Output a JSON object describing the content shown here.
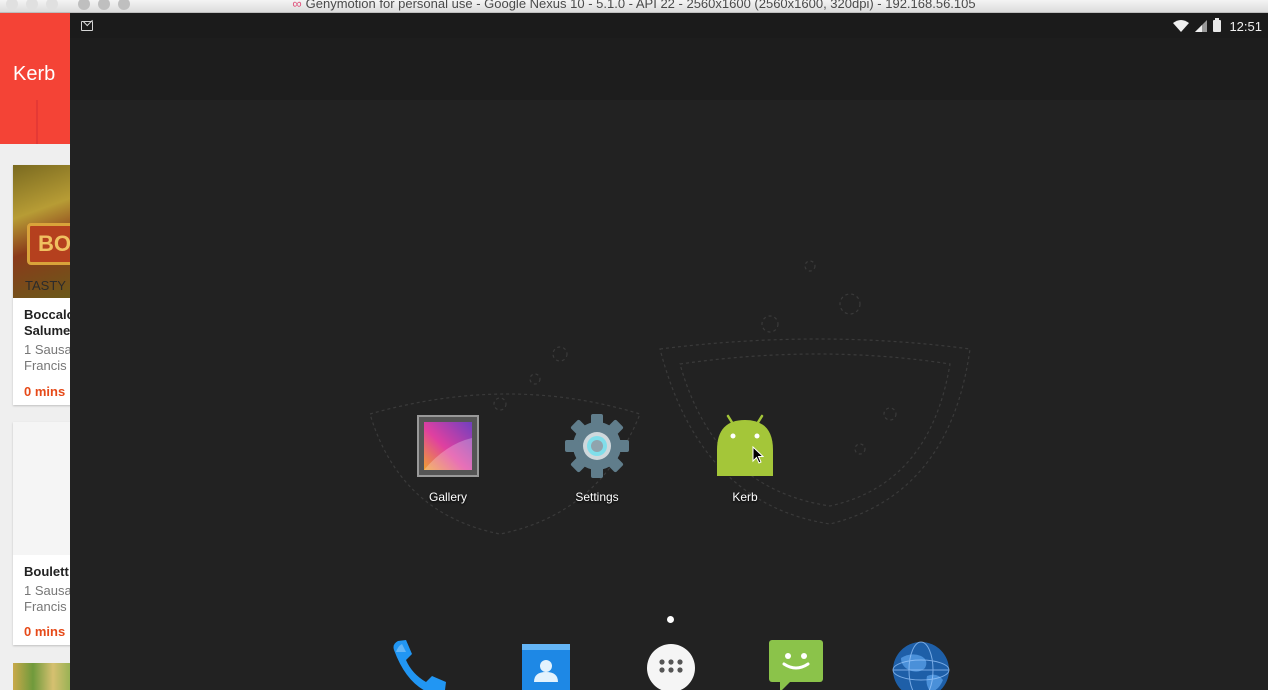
{
  "window": {
    "title": "Genymotion for personal use - Google Nexus 10 - 5.1.0 - API 22 - 2560x1600 (2560x1600, 320dpi) - 192.168.56.105",
    "logo_icon": "genymotion-logo-icon"
  },
  "back_app": {
    "toolbar_title": "Kerb",
    "cards": [
      {
        "image_sign": "BO",
        "image_caption": "TASTY",
        "title_line1": "Boccalo",
        "title_line2": "Salume",
        "address_line1": "1 Sausa",
        "address_line2": "Francis",
        "time": "0 mins"
      },
      {
        "title_line1": "Boulett",
        "address_line1": "1 Sausa",
        "address_line2": "Francis",
        "time": "0 mins"
      }
    ]
  },
  "statusbar": {
    "notification_icon": "gmail-icon",
    "wifi_icon": "wifi-icon",
    "signal_icon": "signal-icon",
    "battery_icon": "battery-icon",
    "time": "12:51"
  },
  "home": {
    "apps": [
      {
        "label": "Gallery",
        "icon": "gallery-icon"
      },
      {
        "label": "Settings",
        "icon": "settings-gear-icon"
      },
      {
        "label": "Kerb",
        "icon": "android-icon"
      }
    ],
    "page_indicator_count": 1
  },
  "dock": [
    {
      "name": "phone",
      "icon": "phone-icon"
    },
    {
      "name": "people",
      "icon": "contacts-icon"
    },
    {
      "name": "all-apps",
      "icon": "app-drawer-icon"
    },
    {
      "name": "messaging",
      "icon": "messaging-icon"
    },
    {
      "name": "browser",
      "icon": "globe-icon"
    }
  ],
  "colors": {
    "kerb_red": "#f44336",
    "time_orange": "#e64a19",
    "android_green": "#a4c639",
    "screen_bg": "#202020"
  }
}
